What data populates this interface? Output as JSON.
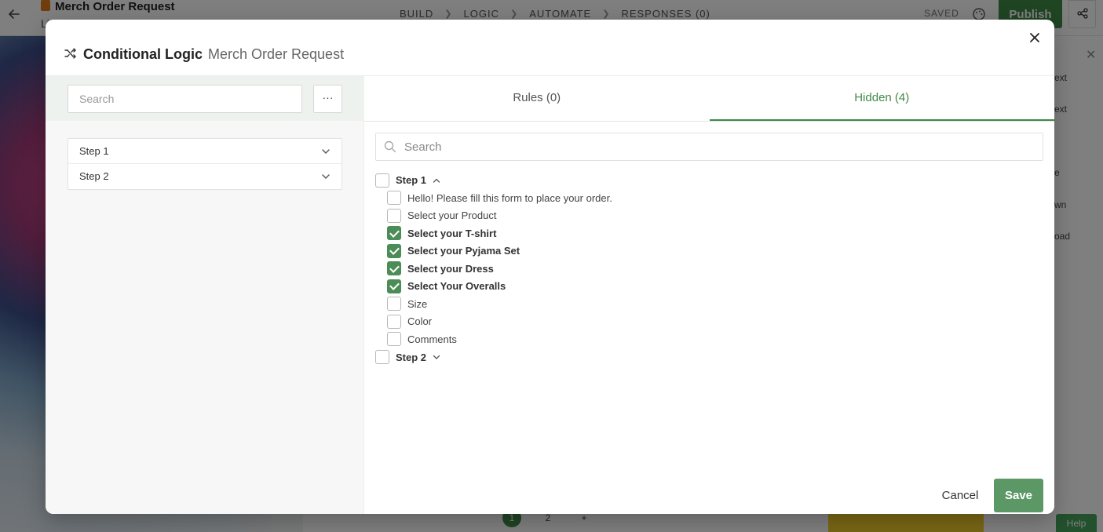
{
  "app": {
    "form_title": "Merch Order Request",
    "form_subtitle": "Li",
    "nav": [
      {
        "label": "BUILD"
      },
      {
        "label": "LOGIC"
      },
      {
        "label": "AUTOMATE"
      },
      {
        "label": "RESPONSES (0)"
      }
    ],
    "saved_label": "SAVED",
    "publish_label": "Publish",
    "help_label": "Help",
    "right_panel_texts": [
      "ext",
      "ext",
      "e",
      "wn",
      "oad"
    ],
    "pager": [
      "1",
      "2",
      "+"
    ]
  },
  "modal": {
    "title": "Conditional Logic",
    "subtitle": "Merch Order Request",
    "left": {
      "search_placeholder": "Search",
      "more_label": "···",
      "steps": [
        {
          "label": "Step 1"
        },
        {
          "label": "Step 2"
        }
      ]
    },
    "tabs": [
      {
        "label": "Rules (0)",
        "active": false
      },
      {
        "label": "Hidden (4)",
        "active": true
      }
    ],
    "hidden": {
      "search_placeholder": "Search",
      "groups": [
        {
          "label": "Step 1",
          "expanded": true,
          "checked": false,
          "items": [
            {
              "label": "Hello! Please fill this form to place your order.",
              "checked": false
            },
            {
              "label": "Select your Product",
              "checked": false
            },
            {
              "label": "Select your T-shirt",
              "checked": true
            },
            {
              "label": "Select your Pyjama Set",
              "checked": true
            },
            {
              "label": "Select your Dress",
              "checked": true
            },
            {
              "label": "Select Your Overalls",
              "checked": true
            },
            {
              "label": "Size",
              "checked": false
            },
            {
              "label": "Color",
              "checked": false
            },
            {
              "label": "Comments",
              "checked": false
            }
          ]
        },
        {
          "label": "Step 2",
          "expanded": false,
          "checked": false,
          "items": []
        }
      ]
    },
    "footer": {
      "cancel_label": "Cancel",
      "save_label": "Save"
    }
  },
  "colors": {
    "accent": "#3f8a47",
    "save_button": "#5c9866",
    "checkbox_checked": "#4c8d57"
  },
  "icons": [
    "back-arrow-icon",
    "form-icon",
    "palette-icon",
    "share-icon",
    "shuffle-icon",
    "close-icon",
    "chevron-down-icon",
    "chevron-up-icon",
    "search-icon"
  ]
}
